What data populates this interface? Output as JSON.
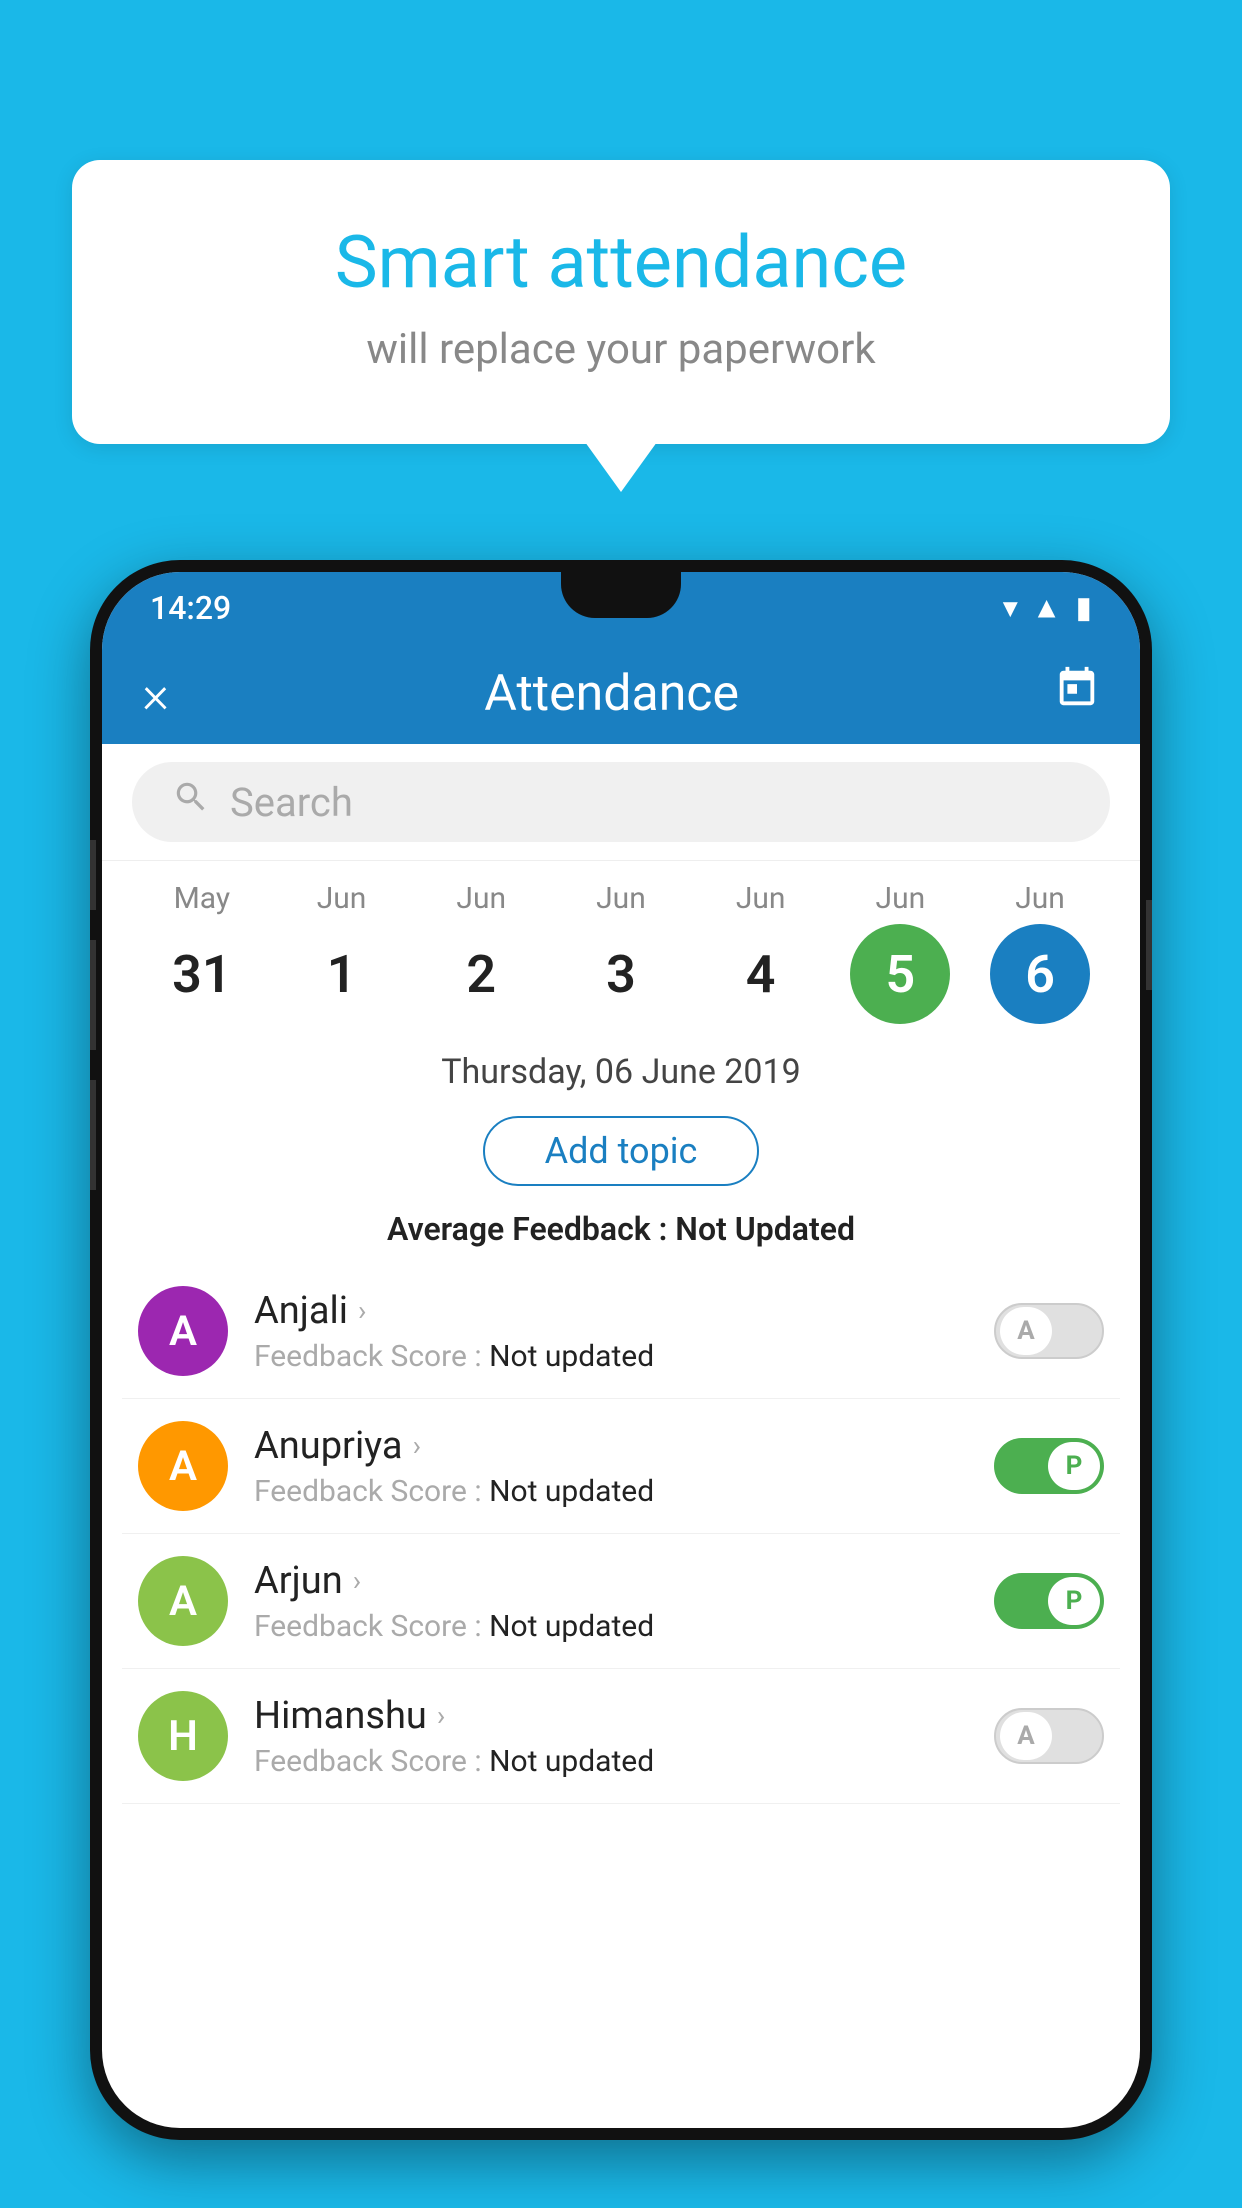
{
  "background_color": "#1ab8e8",
  "bubble": {
    "title": "Smart attendance",
    "subtitle": "will replace your paperwork"
  },
  "status_bar": {
    "time": "14:29"
  },
  "header": {
    "close_label": "×",
    "title": "Attendance",
    "calendar_icon": "📅"
  },
  "search": {
    "placeholder": "Search"
  },
  "calendar": {
    "days": [
      {
        "month": "May",
        "day": "31",
        "style": "normal"
      },
      {
        "month": "Jun",
        "day": "1",
        "style": "normal"
      },
      {
        "month": "Jun",
        "day": "2",
        "style": "normal"
      },
      {
        "month": "Jun",
        "day": "3",
        "style": "normal"
      },
      {
        "month": "Jun",
        "day": "4",
        "style": "normal"
      },
      {
        "month": "Jun",
        "day": "5",
        "style": "selected-green"
      },
      {
        "month": "Jun",
        "day": "6",
        "style": "selected-blue"
      }
    ]
  },
  "selected_date": "Thursday, 06 June 2019",
  "add_topic_label": "Add topic",
  "avg_feedback_label": "Average Feedback :",
  "avg_feedback_value": "Not Updated",
  "students": [
    {
      "name": "Anjali",
      "avatar_letter": "A",
      "avatar_color": "#9c27b0",
      "feedback_label": "Feedback Score :",
      "feedback_value": "Not updated",
      "toggle_state": "off",
      "toggle_label": "A"
    },
    {
      "name": "Anupriya",
      "avatar_letter": "A",
      "avatar_color": "#ff9800",
      "feedback_label": "Feedback Score :",
      "feedback_value": "Not updated",
      "toggle_state": "on",
      "toggle_label": "P"
    },
    {
      "name": "Arjun",
      "avatar_letter": "A",
      "avatar_color": "#8bc34a",
      "feedback_label": "Feedback Score :",
      "feedback_value": "Not updated",
      "toggle_state": "on",
      "toggle_label": "P"
    },
    {
      "name": "Himanshu",
      "avatar_letter": "H",
      "avatar_color": "#8bc34a",
      "feedback_label": "Feedback Score :",
      "feedback_value": "Not updated",
      "toggle_state": "off",
      "toggle_label": "A"
    }
  ]
}
